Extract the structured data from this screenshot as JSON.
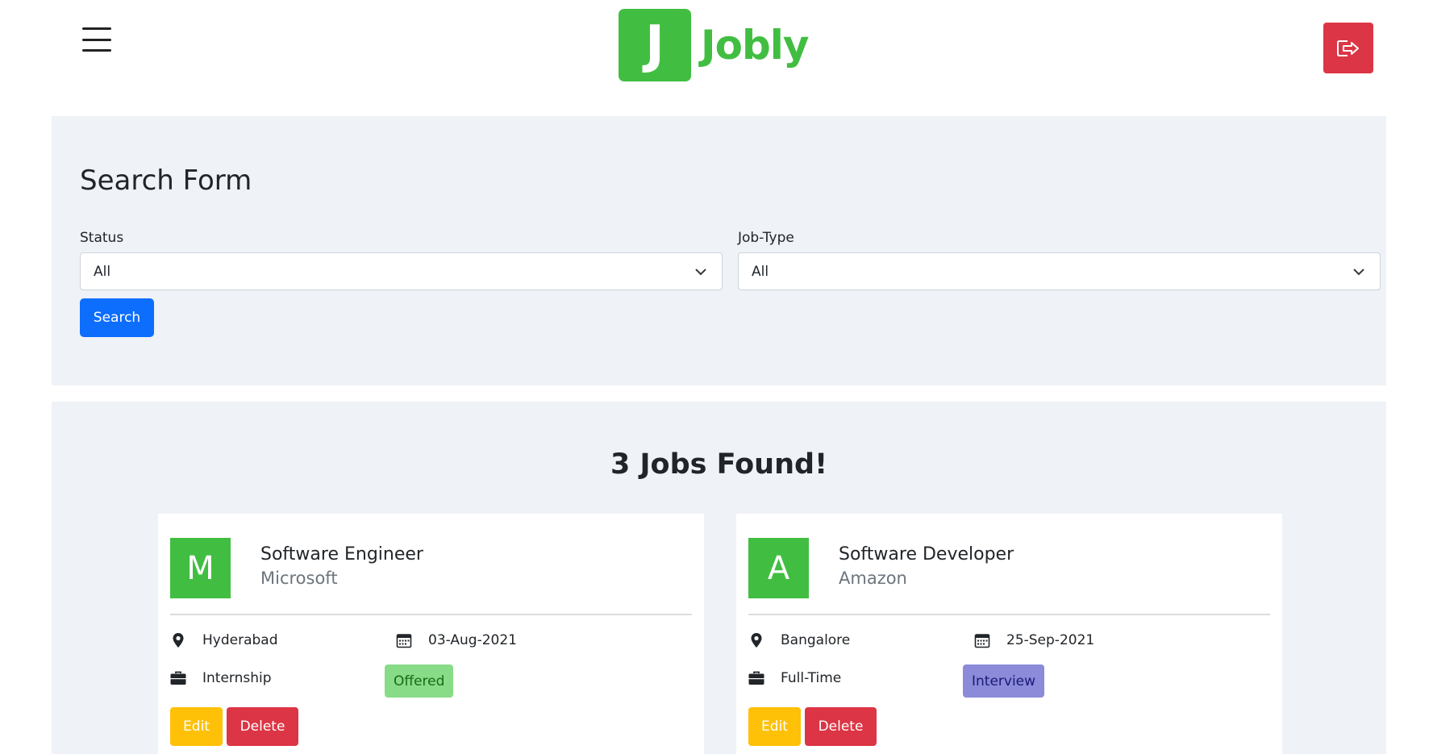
{
  "app": {
    "brand_letter": "J",
    "brand_name": "Jobly",
    "brand_color": "#41be41"
  },
  "navbar": {
    "menu_icon": "hamburger-icon",
    "logout_icon": "logout-icon"
  },
  "search_form": {
    "title": "Search Form",
    "status_label": "Status",
    "status_value": "All",
    "job_type_label": "Job-Type",
    "job_type_value": "All",
    "search_button": "Search"
  },
  "results": {
    "title": "3 Jobs Found!",
    "jobs": [
      {
        "initial": "M",
        "position": "Software Engineer",
        "company": "Microsoft",
        "location": "Hyderabad",
        "date": "03-Aug-2021",
        "job_type": "Internship",
        "status": "Offered",
        "status_color": "#88dc88",
        "edit_label": "Edit",
        "delete_label": "Delete"
      },
      {
        "initial": "A",
        "position": "Software Developer",
        "company": "Amazon",
        "location": "Bangalore",
        "date": "25-Sep-2021",
        "job_type": "Full-Time",
        "status": "Interview",
        "status_color": "#8b8bd9",
        "edit_label": "Edit",
        "delete_label": "Delete"
      }
    ]
  }
}
